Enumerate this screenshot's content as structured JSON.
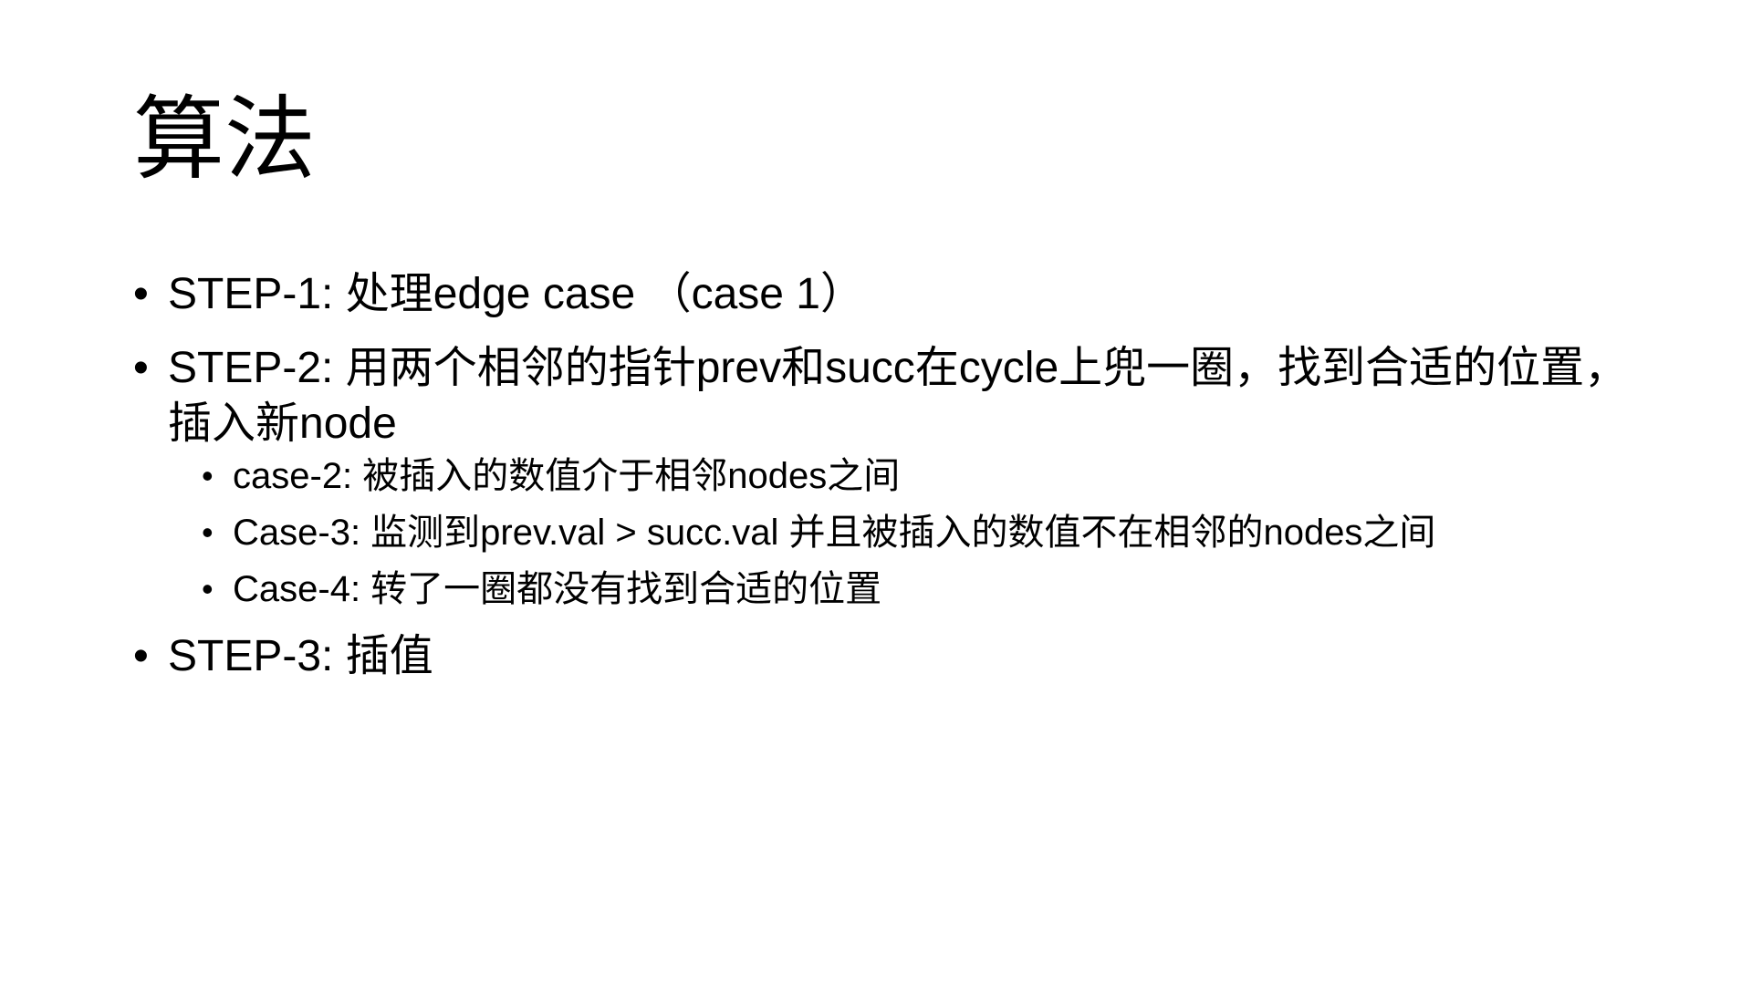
{
  "slide": {
    "title": "算法",
    "steps": [
      {
        "text": "STEP-1: 处理edge case （case 1）",
        "sub": []
      },
      {
        "text": "STEP-2: 用两个相邻的指针prev和succ在cycle上兜一圈，找到合适的位置，插入新node",
        "sub": [
          "case-2: 被插入的数值介于相邻nodes之间",
          "Case-3: 监测到prev.val > succ.val 并且被插入的数值不在相邻的nodes之间",
          "Case-4: 转了一圈都没有找到合适的位置"
        ]
      },
      {
        "text": "STEP-3: 插值",
        "sub": []
      }
    ],
    "bullet_char": "•"
  }
}
